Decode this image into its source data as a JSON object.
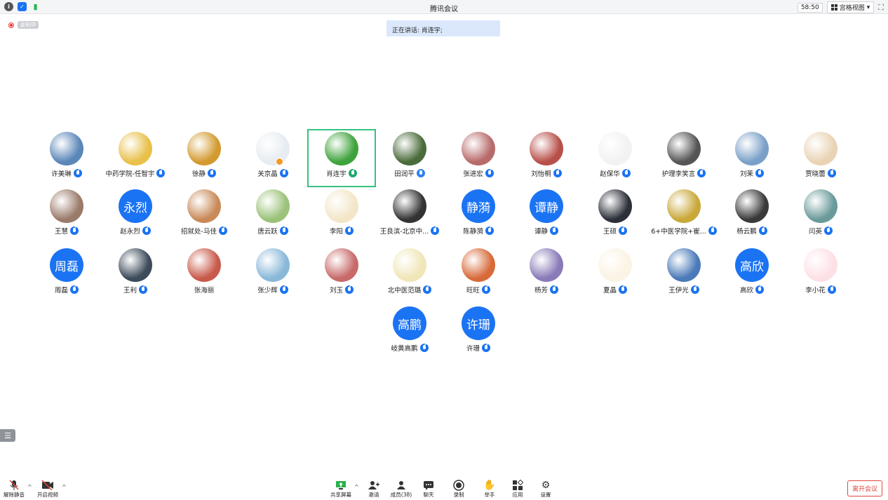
{
  "window": {
    "title": "腾讯会议"
  },
  "timer": "58:50",
  "view_mode": "宫格视图",
  "recording_label": "录制中",
  "speaking_banner": "正在讲话: 肖连宇;",
  "participants": [
    {
      "name": "许美琳",
      "avatar": "photo",
      "color": "#5a86b8"
    },
    {
      "name": "中药学院-任智宇",
      "avatar": "photo",
      "color": "#e8c04a"
    },
    {
      "name": "徐静",
      "avatar": "photo",
      "color": "#d39a2f"
    },
    {
      "name": "关京晶",
      "avatar": "photo",
      "color": "#e7ecf2",
      "host": true
    },
    {
      "name": "肖连宇",
      "avatar": "photo",
      "color": "#3fa33c",
      "active": true
    },
    {
      "name": "田润平",
      "avatar": "photo",
      "color": "#4a6b3a",
      "mic_on": true
    },
    {
      "name": "张进宏",
      "avatar": "photo",
      "color": "#b86a6a"
    },
    {
      "name": "刘怡桐",
      "avatar": "photo",
      "color": "#b8504a"
    },
    {
      "name": "赵保华",
      "avatar": "photo",
      "color": "#f2f2f2"
    },
    {
      "name": "护理李笑言",
      "avatar": "photo",
      "color": "#555555"
    },
    {
      "name": "刘茉",
      "avatar": "photo",
      "color": "#7aa0c8"
    },
    {
      "name": "贾晓蕾",
      "avatar": "photo",
      "color": "#e9d3b4"
    },
    {
      "name": "王慧",
      "avatar": "photo",
      "color": "#9a7a6a"
    },
    {
      "name": "赵永烈",
      "avatar": "text",
      "text": "永烈"
    },
    {
      "name": "招就处-马佳",
      "avatar": "photo",
      "color": "#c98a5a"
    },
    {
      "name": "唐云跃",
      "avatar": "photo",
      "color": "#9cc27a"
    },
    {
      "name": "李阳",
      "avatar": "photo",
      "color": "#f3e6c8"
    },
    {
      "name": "王良滨-北京中...",
      "avatar": "photo",
      "color": "#333333"
    },
    {
      "name": "陈静漪",
      "avatar": "text",
      "text": "静漪"
    },
    {
      "name": "谭静",
      "avatar": "text",
      "text": "谭静"
    },
    {
      "name": "王硕",
      "avatar": "photo",
      "color": "#2b2f38"
    },
    {
      "name": "6+中医学院+崔...",
      "avatar": "photo",
      "color": "#c9a83a"
    },
    {
      "name": "杨云鹏",
      "avatar": "photo",
      "color": "#3a3a3a"
    },
    {
      "name": "闫英",
      "avatar": "photo",
      "color": "#6a9a9a"
    },
    {
      "name": "周磊",
      "avatar": "text",
      "text": "周磊"
    },
    {
      "name": "王利",
      "avatar": "photo",
      "color": "#3c4a5a"
    },
    {
      "name": "张海丽",
      "avatar": "photo",
      "color": "#c85a4a",
      "no_mic": true
    },
    {
      "name": "张少辉",
      "avatar": "photo",
      "color": "#8ab8d8"
    },
    {
      "name": "刘玉",
      "avatar": "photo",
      "color": "#c86a6a"
    },
    {
      "name": "北中医范璐",
      "avatar": "photo",
      "color": "#f0e6b8"
    },
    {
      "name": "旺旺",
      "avatar": "photo",
      "color": "#d86a3a"
    },
    {
      "name": "杨芳",
      "avatar": "photo",
      "color": "#8a7ab8"
    },
    {
      "name": "夏晶",
      "avatar": "photo",
      "color": "#fbf3e3"
    },
    {
      "name": "王伊光",
      "avatar": "photo",
      "color": "#4a7ab8"
    },
    {
      "name": "高欣",
      "avatar": "text",
      "text": "高欣"
    },
    {
      "name": "李小花",
      "avatar": "photo",
      "color": "#fde0e6"
    },
    {
      "name": "岐黄高鹏",
      "avatar": "text",
      "text": "高鹏"
    },
    {
      "name": "许珊",
      "avatar": "text",
      "text": "许珊"
    }
  ],
  "toolbar": {
    "unmute": "解除静音",
    "start_video": "开启视频",
    "share_screen": "共享屏幕",
    "invite": "邀请",
    "members": "成员(38)",
    "chat": "聊天",
    "record": "录制",
    "raise_hand": "举手",
    "apps": "应用",
    "settings": "设置",
    "leave": "离开会议"
  }
}
